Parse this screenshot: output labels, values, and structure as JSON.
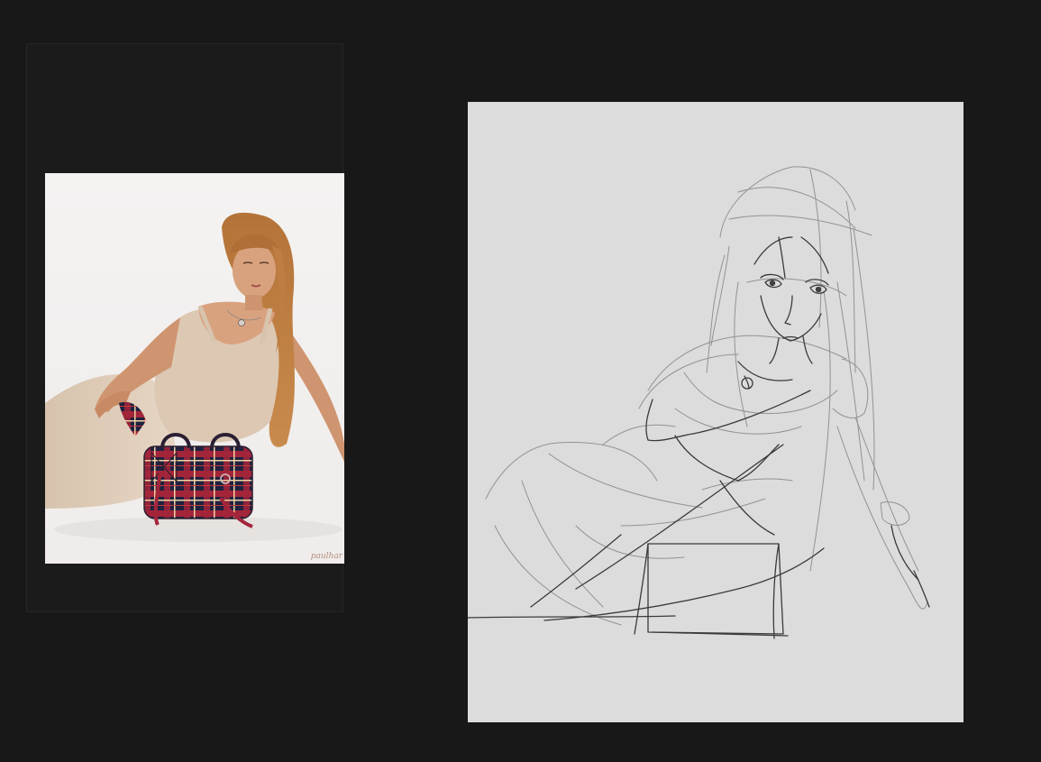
{
  "workspace": {
    "background": "#181818"
  },
  "reference": {
    "signature": "paulhar",
    "colors": {
      "backdrop": "#f3f1f0",
      "skin": "#d9a27f",
      "hair": "#b8773f",
      "dress": "#dfcdb9",
      "plaid_red": "#a3253a",
      "plaid_navy": "#1e2240"
    }
  },
  "canvas": {
    "background": "#dcdcdc",
    "stroke_color": "#3a3a3a"
  }
}
